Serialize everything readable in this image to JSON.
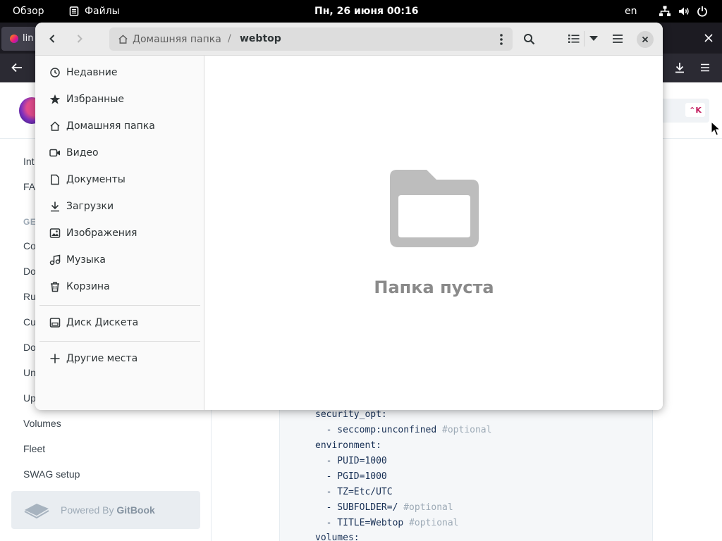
{
  "topbar": {
    "activities": "Обзор",
    "app_name": "Файлы",
    "clock": "Пн, 26 июня  00:16",
    "language": "en"
  },
  "browser": {
    "tab_label": "lin",
    "search_shortcut": "⌃K"
  },
  "docs_sidebar": {
    "items": [
      {
        "label": "Int"
      },
      {
        "label": "FA"
      },
      {
        "label": "GE"
      },
      {
        "label": "Co"
      },
      {
        "label": "Do"
      },
      {
        "label": "Ru"
      },
      {
        "label": "Cu"
      },
      {
        "label": "Do"
      },
      {
        "label": "Un"
      },
      {
        "label": "Up"
      },
      {
        "label": "Volumes"
      },
      {
        "label": "Fleet"
      },
      {
        "label": "SWAG setup"
      }
    ],
    "powered_by": "Powered By",
    "gitbook": "GitBook"
  },
  "code": {
    "lines": [
      {
        "text": "security_opt:",
        "comment": ""
      },
      {
        "text": "  - seccomp:unconfined ",
        "comment": "#optional"
      },
      {
        "text": "environment:",
        "comment": ""
      },
      {
        "text": "  - PUID=1000",
        "comment": ""
      },
      {
        "text": "  - PGID=1000",
        "comment": ""
      },
      {
        "text": "  - TZ=Etc/UTC",
        "comment": ""
      },
      {
        "text": "  - SUBFOLDER=/ ",
        "comment": "#optional"
      },
      {
        "text": "  - TITLE=Webtop ",
        "comment": "#optional"
      },
      {
        "text": "volumes:",
        "comment": ""
      }
    ]
  },
  "files": {
    "path": {
      "home": "Домашняя папка",
      "separator": "/",
      "current": "webtop"
    },
    "places": [
      {
        "label": "Недавние",
        "icon": "clock-icon"
      },
      {
        "label": "Избранные",
        "icon": "star-icon"
      },
      {
        "label": "Домашняя папка",
        "icon": "home-icon"
      },
      {
        "label": "Видео",
        "icon": "video-icon"
      },
      {
        "label": "Документы",
        "icon": "document-icon"
      },
      {
        "label": "Загрузки",
        "icon": "download-icon"
      },
      {
        "label": "Изображения",
        "icon": "image-icon"
      },
      {
        "label": "Музыка",
        "icon": "music-icon"
      },
      {
        "label": "Корзина",
        "icon": "trash-icon"
      }
    ],
    "devices": [
      {
        "label": "Диск Дискета",
        "icon": "drive-icon"
      }
    ],
    "other_places": {
      "label": "Другие места",
      "icon": "plus-icon"
    },
    "empty_message": "Папка пуста"
  }
}
